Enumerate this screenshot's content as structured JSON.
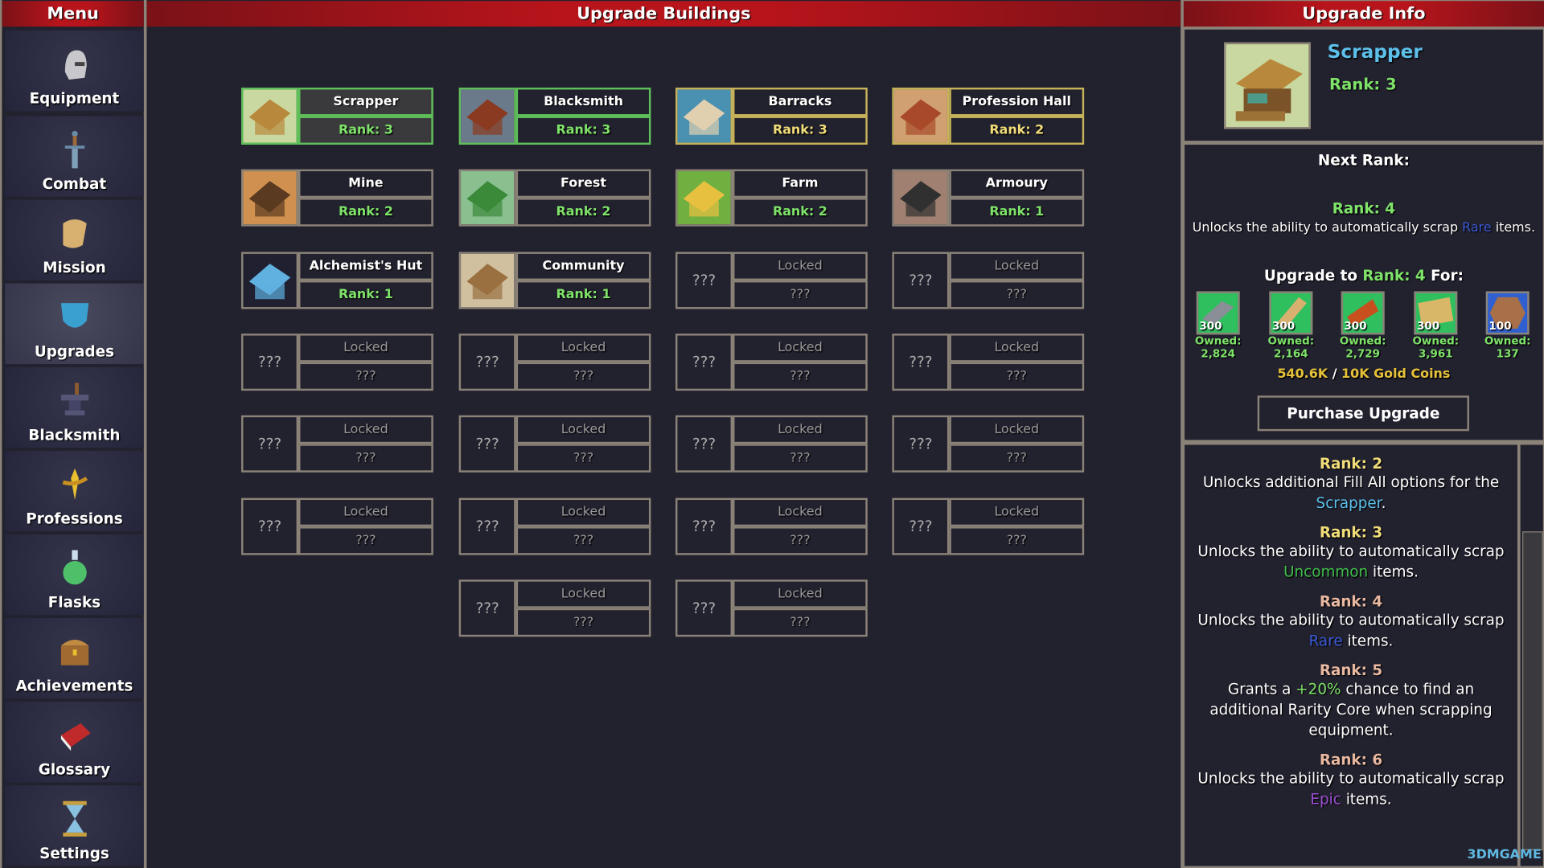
{
  "colors": {
    "header_red": "#b8141b",
    "green": "#7fe36a",
    "gold": "#f0dd7a",
    "scrapper_blue": "#5cc0ea",
    "uncommon": "#3fbf4a",
    "rare": "#3b5bd6",
    "epic": "#9b4fd0",
    "future_rank": "#e8b8a0",
    "gold_coins": "#e6c23a"
  },
  "menu": {
    "title": "Menu",
    "items": [
      {
        "label": "Equipment",
        "icon": "helmet-icon"
      },
      {
        "label": "Combat",
        "icon": "sword-icon"
      },
      {
        "label": "Mission",
        "icon": "scroll-icon"
      },
      {
        "label": "Upgrades",
        "icon": "shield-icon",
        "active": true
      },
      {
        "label": "Blacksmith",
        "icon": "anvil-icon"
      },
      {
        "label": "Professions",
        "icon": "wheat-icon"
      },
      {
        "label": "Flasks",
        "icon": "flask-icon"
      },
      {
        "label": "Achievements",
        "icon": "chest-icon"
      },
      {
        "label": "Glossary",
        "icon": "book-icon"
      },
      {
        "label": "Settings",
        "icon": "hourglass-icon"
      }
    ]
  },
  "buildings": {
    "title": "Upgrade Buildings",
    "rows": [
      [
        {
          "name": "Scrapper",
          "rank": "Rank: 3",
          "state": "green selected",
          "icon": "scrapper-icon"
        },
        {
          "name": "Blacksmith",
          "rank": "Rank: 3",
          "state": "green",
          "icon": "blacksmith-icon"
        },
        {
          "name": "Barracks",
          "rank": "Rank: 3",
          "state": "gold",
          "icon": "barracks-icon"
        },
        {
          "name": "Profession Hall",
          "rank": "Rank: 2",
          "state": "gold",
          "icon": "profession-hall-icon"
        }
      ],
      [
        {
          "name": "Mine",
          "rank": "Rank: 2",
          "state": "normal",
          "icon": "mine-icon"
        },
        {
          "name": "Forest",
          "rank": "Rank: 2",
          "state": "normal",
          "icon": "forest-icon"
        },
        {
          "name": "Farm",
          "rank": "Rank: 2",
          "state": "normal",
          "icon": "farm-icon"
        },
        {
          "name": "Armoury",
          "rank": "Rank: 1",
          "state": "normal",
          "icon": "armoury-icon"
        }
      ],
      [
        {
          "name": "Alchemist's Hut",
          "rank": "Rank: 1",
          "state": "normal",
          "icon": "alchemist-icon"
        },
        {
          "name": "Community Project",
          "rank": "Rank: 1",
          "state": "normal",
          "icon": "community-project-icon"
        },
        {
          "name": "Locked",
          "rank": "???",
          "state": "locked",
          "icon_text": "???"
        },
        {
          "name": "Locked",
          "rank": "???",
          "state": "locked",
          "icon_text": "???"
        }
      ],
      [
        {
          "name": "Locked",
          "rank": "???",
          "state": "locked",
          "icon_text": "???"
        },
        {
          "name": "Locked",
          "rank": "???",
          "state": "locked",
          "icon_text": "???"
        },
        {
          "name": "Locked",
          "rank": "???",
          "state": "locked",
          "icon_text": "???"
        },
        {
          "name": "Locked",
          "rank": "???",
          "state": "locked",
          "icon_text": "???"
        }
      ],
      [
        {
          "name": "Locked",
          "rank": "???",
          "state": "locked",
          "icon_text": "???"
        },
        {
          "name": "Locked",
          "rank": "???",
          "state": "locked",
          "icon_text": "???"
        },
        {
          "name": "Locked",
          "rank": "???",
          "state": "locked",
          "icon_text": "???"
        },
        {
          "name": "Locked",
          "rank": "???",
          "state": "locked",
          "icon_text": "???"
        }
      ],
      [
        {
          "name": "Locked",
          "rank": "???",
          "state": "locked",
          "icon_text": "???"
        },
        {
          "name": "Locked",
          "rank": "???",
          "state": "locked",
          "icon_text": "???"
        },
        {
          "name": "Locked",
          "rank": "???",
          "state": "locked",
          "icon_text": "???"
        },
        {
          "name": "Locked",
          "rank": "???",
          "state": "locked",
          "icon_text": "???"
        }
      ],
      [
        null,
        {
          "name": "Locked",
          "rank": "???",
          "state": "locked",
          "icon_text": "???"
        },
        {
          "name": "Locked",
          "rank": "???",
          "state": "locked",
          "icon_text": "???"
        },
        null
      ]
    ]
  },
  "info": {
    "title": "Upgrade Info",
    "selected_name": "Scrapper",
    "selected_rank": "Rank: 3",
    "next_rank_label": "Next Rank:",
    "next_rank": "Rank: 4",
    "next_desc": [
      {
        "t": "Unlocks the ability to automatically scrap "
      },
      {
        "t": "Rare",
        "c": "rare"
      },
      {
        "t": " items."
      }
    ],
    "upgrade_to": [
      {
        "t": "Upgrade to "
      },
      {
        "t": "Rank: 4",
        "c": "green"
      },
      {
        "t": " For:"
      }
    ],
    "costs": [
      {
        "qty": "300",
        "owned_label": "Owned:",
        "owned": "2,824",
        "icon": "metal-bar-icon",
        "bg": "#2fbf5f"
      },
      {
        "qty": "300",
        "owned_label": "Owned:",
        "owned": "2,164",
        "icon": "wood-plank-icon",
        "bg": "#2fbf5f"
      },
      {
        "qty": "300",
        "owned_label": "Owned:",
        "owned": "2,729",
        "icon": "leather-icon",
        "bg": "#2fbf5f"
      },
      {
        "qty": "300",
        "owned_label": "Owned:",
        "owned": "3,961",
        "icon": "cloth-icon",
        "bg": "#2fbf5f"
      },
      {
        "qty": "100",
        "owned_label": "Owned:",
        "owned": "137",
        "icon": "rune-stone-icon",
        "bg": "#2f5fd0"
      }
    ],
    "gold": [
      {
        "t": "540.6K",
        "c": "gold_coins"
      },
      {
        "t": " / "
      },
      {
        "t": "10K Gold Coins",
        "c": "gold_coins"
      }
    ],
    "purchase_label": "Purchase Upgrade",
    "history": [
      {
        "rank": "Rank: 2",
        "rc": "gold",
        "desc": [
          {
            "t": "Unlocks additional Fill All options for the "
          },
          {
            "t": "Scrapper",
            "c": "scrapper_blue"
          },
          {
            "t": "."
          }
        ]
      },
      {
        "rank": "Rank: 3",
        "rc": "gold",
        "desc": [
          {
            "t": "Unlocks the ability to automatically scrap "
          },
          {
            "t": "Uncommon",
            "c": "uncommon"
          },
          {
            "t": " items."
          }
        ]
      },
      {
        "rank": "Rank: 4",
        "rc": "future_rank",
        "desc": [
          {
            "t": "Unlocks the ability to automatically scrap "
          },
          {
            "t": "Rare",
            "c": "rare"
          },
          {
            "t": " items."
          }
        ]
      },
      {
        "rank": "Rank: 5",
        "rc": "future_rank",
        "desc": [
          {
            "t": "Grants a "
          },
          {
            "t": "+20%",
            "c": "green"
          },
          {
            "t": " chance to find an additional Rarity Core when scrapping equipment."
          }
        ]
      },
      {
        "rank": "Rank: 6",
        "rc": "future_rank",
        "desc": [
          {
            "t": "Unlocks the ability to automatically scrap "
          },
          {
            "t": "Epic",
            "c": "epic"
          },
          {
            "t": " items."
          }
        ]
      }
    ],
    "watermark": "3DMGAME"
  }
}
